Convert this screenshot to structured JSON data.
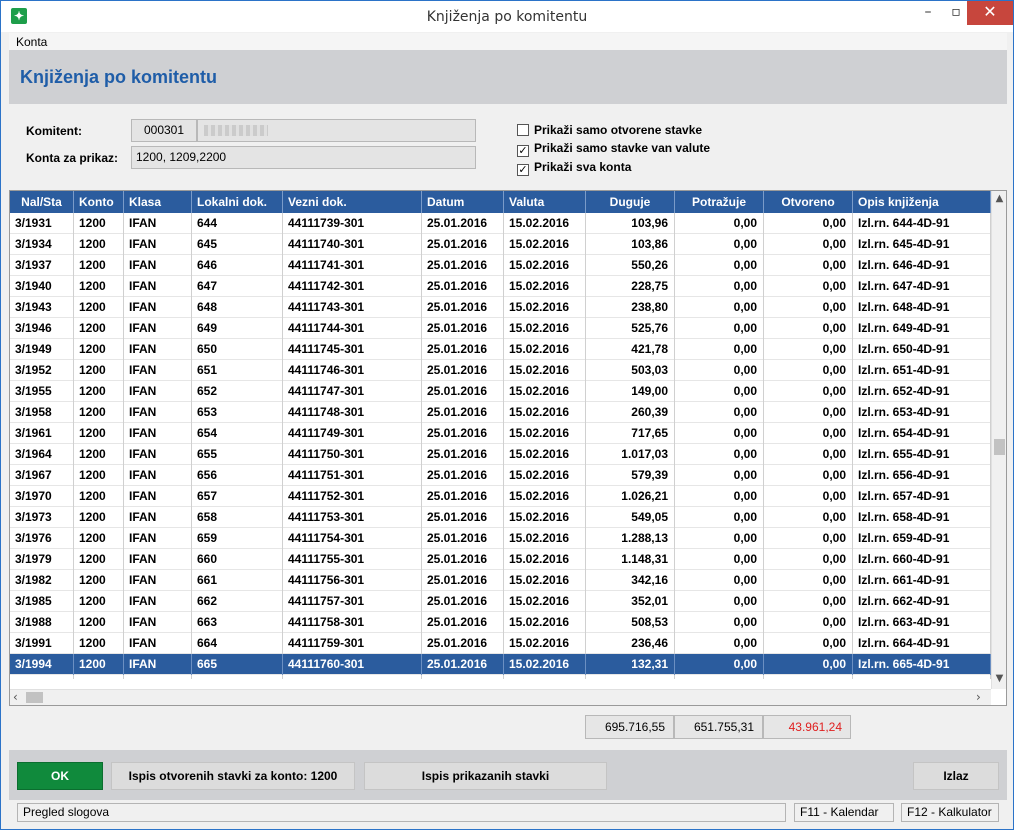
{
  "window": {
    "title": "Knjiženja po komitentu",
    "icon": "app-icon",
    "controls": {
      "minimize": "–",
      "maximize": "▫",
      "close": "✕"
    }
  },
  "menu": {
    "konta": "Konta"
  },
  "header": {
    "title": "Knjiženja po komitentu"
  },
  "filter": {
    "komitent_label": "Komitent:",
    "komitent_code": "000301",
    "konta_label": "Konta za prikaz:",
    "konta_value": "1200, 1209,2200",
    "checkboxes": [
      {
        "label": "Prikaži samo otvorene stavke",
        "checked": false
      },
      {
        "label": "Prikaži samo stavke van valute",
        "checked": true
      },
      {
        "label": "Prikaži sva konta",
        "checked": true
      }
    ]
  },
  "grid": {
    "columns": [
      "Nal/Sta",
      "Konto",
      "Klasa",
      "Lokalni dok.",
      "Vezni dok.",
      "Datum",
      "Valuta",
      "Duguje",
      "Potražuje",
      "Otvoreno",
      "Opis knjiženja"
    ],
    "rows": [
      [
        "3/1931",
        "1200",
        "IFAN",
        "644",
        "44111739-301",
        "25.01.2016",
        "15.02.2016",
        "103,96",
        "0,00",
        "0,00",
        "Izl.rn. 644-4D-91"
      ],
      [
        "3/1934",
        "1200",
        "IFAN",
        "645",
        "44111740-301",
        "25.01.2016",
        "15.02.2016",
        "103,86",
        "0,00",
        "0,00",
        "Izl.rn. 645-4D-91"
      ],
      [
        "3/1937",
        "1200",
        "IFAN",
        "646",
        "44111741-301",
        "25.01.2016",
        "15.02.2016",
        "550,26",
        "0,00",
        "0,00",
        "Izl.rn. 646-4D-91"
      ],
      [
        "3/1940",
        "1200",
        "IFAN",
        "647",
        "44111742-301",
        "25.01.2016",
        "15.02.2016",
        "228,75",
        "0,00",
        "0,00",
        "Izl.rn. 647-4D-91"
      ],
      [
        "3/1943",
        "1200",
        "IFAN",
        "648",
        "44111743-301",
        "25.01.2016",
        "15.02.2016",
        "238,80",
        "0,00",
        "0,00",
        "Izl.rn. 648-4D-91"
      ],
      [
        "3/1946",
        "1200",
        "IFAN",
        "649",
        "44111744-301",
        "25.01.2016",
        "15.02.2016",
        "525,76",
        "0,00",
        "0,00",
        "Izl.rn. 649-4D-91"
      ],
      [
        "3/1949",
        "1200",
        "IFAN",
        "650",
        "44111745-301",
        "25.01.2016",
        "15.02.2016",
        "421,78",
        "0,00",
        "0,00",
        "Izl.rn. 650-4D-91"
      ],
      [
        "3/1952",
        "1200",
        "IFAN",
        "651",
        "44111746-301",
        "25.01.2016",
        "15.02.2016",
        "503,03",
        "0,00",
        "0,00",
        "Izl.rn. 651-4D-91"
      ],
      [
        "3/1955",
        "1200",
        "IFAN",
        "652",
        "44111747-301",
        "25.01.2016",
        "15.02.2016",
        "149,00",
        "0,00",
        "0,00",
        "Izl.rn. 652-4D-91"
      ],
      [
        "3/1958",
        "1200",
        "IFAN",
        "653",
        "44111748-301",
        "25.01.2016",
        "15.02.2016",
        "260,39",
        "0,00",
        "0,00",
        "Izl.rn. 653-4D-91"
      ],
      [
        "3/1961",
        "1200",
        "IFAN",
        "654",
        "44111749-301",
        "25.01.2016",
        "15.02.2016",
        "717,65",
        "0,00",
        "0,00",
        "Izl.rn. 654-4D-91"
      ],
      [
        "3/1964",
        "1200",
        "IFAN",
        "655",
        "44111750-301",
        "25.01.2016",
        "15.02.2016",
        "1.017,03",
        "0,00",
        "0,00",
        "Izl.rn. 655-4D-91"
      ],
      [
        "3/1967",
        "1200",
        "IFAN",
        "656",
        "44111751-301",
        "25.01.2016",
        "15.02.2016",
        "579,39",
        "0,00",
        "0,00",
        "Izl.rn. 656-4D-91"
      ],
      [
        "3/1970",
        "1200",
        "IFAN",
        "657",
        "44111752-301",
        "25.01.2016",
        "15.02.2016",
        "1.026,21",
        "0,00",
        "0,00",
        "Izl.rn. 657-4D-91"
      ],
      [
        "3/1973",
        "1200",
        "IFAN",
        "658",
        "44111753-301",
        "25.01.2016",
        "15.02.2016",
        "549,05",
        "0,00",
        "0,00",
        "Izl.rn. 658-4D-91"
      ],
      [
        "3/1976",
        "1200",
        "IFAN",
        "659",
        "44111754-301",
        "25.01.2016",
        "15.02.2016",
        "1.288,13",
        "0,00",
        "0,00",
        "Izl.rn. 659-4D-91"
      ],
      [
        "3/1979",
        "1200",
        "IFAN",
        "660",
        "44111755-301",
        "25.01.2016",
        "15.02.2016",
        "1.148,31",
        "0,00",
        "0,00",
        "Izl.rn. 660-4D-91"
      ],
      [
        "3/1982",
        "1200",
        "IFAN",
        "661",
        "44111756-301",
        "25.01.2016",
        "15.02.2016",
        "342,16",
        "0,00",
        "0,00",
        "Izl.rn. 661-4D-91"
      ],
      [
        "3/1985",
        "1200",
        "IFAN",
        "662",
        "44111757-301",
        "25.01.2016",
        "15.02.2016",
        "352,01",
        "0,00",
        "0,00",
        "Izl.rn. 662-4D-91"
      ],
      [
        "3/1988",
        "1200",
        "IFAN",
        "663",
        "44111758-301",
        "25.01.2016",
        "15.02.2016",
        "508,53",
        "0,00",
        "0,00",
        "Izl.rn. 663-4D-91"
      ],
      [
        "3/1991",
        "1200",
        "IFAN",
        "664",
        "44111759-301",
        "25.01.2016",
        "15.02.2016",
        "236,46",
        "0,00",
        "0,00",
        "Izl.rn. 664-4D-91"
      ],
      [
        "3/1994",
        "1200",
        "IFAN",
        "665",
        "44111760-301",
        "25.01.2016",
        "15.02.2016",
        "132,31",
        "0,00",
        "0,00",
        "Izl.rn. 665-4D-91"
      ]
    ],
    "selected_row": 21
  },
  "totals": {
    "duguje": "695.716,55",
    "potrazuje": "651.755,31",
    "otvoreno": "43.961,24"
  },
  "buttons": {
    "ok": "OK",
    "ispis_otvorenih": "Ispis otvorenih stavki za konto: 1200",
    "ispis_prikazanih": "Ispis prikazanih stavki",
    "izlaz": "Izlaz"
  },
  "statusbar": {
    "left": "Pregled slogova",
    "f11": "F11 - Kalendar",
    "f12": "F12 - Kalkulator"
  },
  "colors": {
    "accent": "#2b5c9e",
    "header_title": "#1f5da8",
    "ok_button": "#108a3c",
    "close_button": "#c7463d",
    "negative_total": "#e02020"
  }
}
